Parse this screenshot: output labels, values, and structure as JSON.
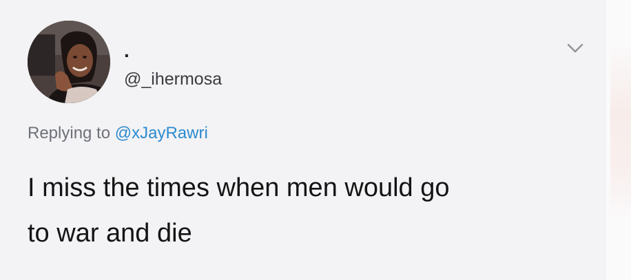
{
  "tweet": {
    "display_name": ".",
    "handle": "@_ihermosa",
    "reply_prefix": "Replying to",
    "reply_handle": "@xJayRawri",
    "text_line_1": "I miss the times when men would go",
    "text_line_2": "to war and die"
  },
  "icons": {
    "menu": "chevron-down-icon",
    "avatar": "profile-photo"
  },
  "colors": {
    "background": "#f3f2f4",
    "link": "#2a8bd0",
    "muted_text": "#6d7178",
    "body_text": "#141414"
  }
}
